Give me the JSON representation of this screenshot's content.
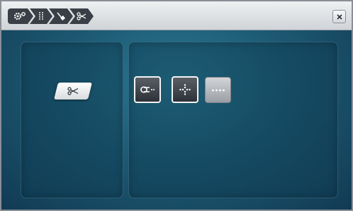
{
  "toolbar": {
    "breadcrumb": [
      {
        "icon": "settings-gear-icon"
      },
      {
        "icon": "stitch-length-icon"
      },
      {
        "icon": "needle-tool-icon"
      },
      {
        "icon": "scissors-icon"
      }
    ],
    "close_icon": "close-icon"
  },
  "panels": {
    "left": {
      "tile_icon": "scissors-icon"
    },
    "right": {
      "options": [
        {
          "icon": "thread-knot-icon",
          "state": "selected"
        },
        {
          "icon": "dot-cross-icon",
          "state": "selected"
        },
        {
          "icon": "dotted-line-icon",
          "state": "unselected"
        }
      ]
    }
  },
  "colors": {
    "background_center": "#2b7a93",
    "background_edge": "#123a53",
    "breadcrumb": "#3a3f47"
  }
}
